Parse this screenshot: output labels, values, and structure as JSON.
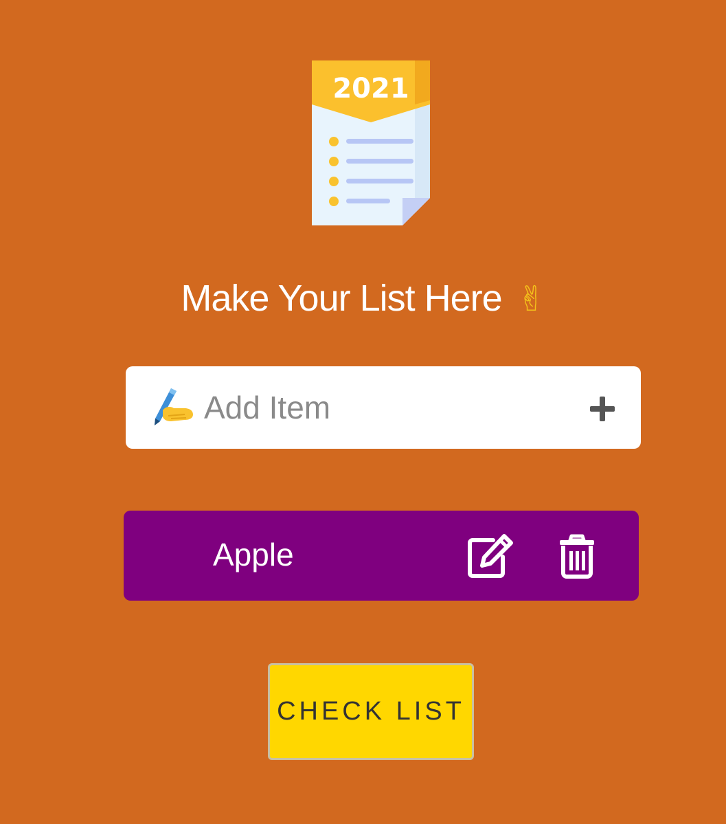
{
  "app": {
    "logo": {
      "year": "2021",
      "icon": "checklist-document-icon"
    },
    "title": "Make Your List Here",
    "title_emoji": "✌",
    "add_item": {
      "placeholder": "Add Item",
      "value": "",
      "leading_icon": "writing-hand-icon",
      "action_icon": "plus-icon"
    },
    "items": [
      {
        "label": "Apple",
        "edit_icon": "edit-icon",
        "delete_icon": "trash-icon"
      }
    ],
    "check_button": {
      "label": "CHECK LIST"
    }
  },
  "colors": {
    "background": "#d2691f",
    "item_background": "#7f007f",
    "button_background": "#ffd700",
    "input_background": "#ffffff",
    "text_light": "#ffffff",
    "logo_header": "#fbc02d",
    "logo_paper": "#e8f4fd",
    "logo_lines": "#b7c6f5",
    "logo_bullets": "#f9c22e"
  }
}
